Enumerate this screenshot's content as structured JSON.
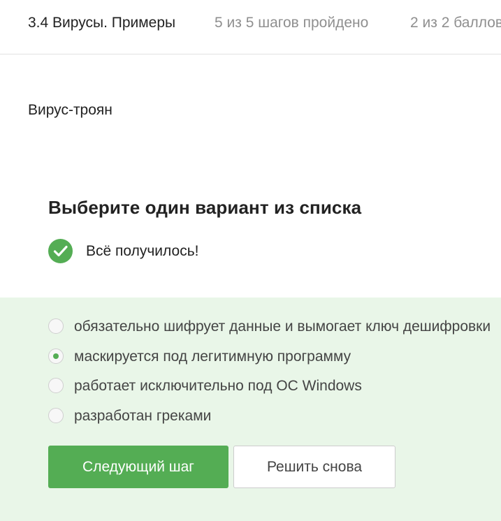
{
  "header": {
    "lesson_title": "3.4 Вирусы. Примеры",
    "progress": "5 из 5 шагов пройдено",
    "score": "2 из 2 баллов"
  },
  "step": {
    "text": "Вирус-троян"
  },
  "quiz": {
    "heading": "Выберите один вариант из списка",
    "feedback": "Всё получилось!",
    "feedback_icon": "check-circle-icon",
    "accent_color": "#54ad54",
    "answers_background": "#e9f6e8",
    "options": [
      {
        "label": "обязательно шифрует данные и вымогает ключ дешифровки",
        "selected": false
      },
      {
        "label": "маскируется под легитимную программу",
        "selected": true
      },
      {
        "label": "работает исключительно под ОС Windows",
        "selected": false
      },
      {
        "label": "разработан греками",
        "selected": false
      }
    ],
    "next_button": "Следующий шаг",
    "retry_button": "Решить снова"
  }
}
